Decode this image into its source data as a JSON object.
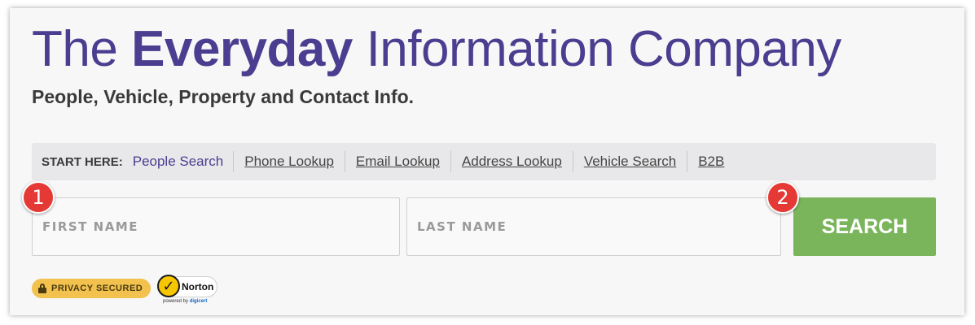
{
  "header": {
    "title_prefix": "The",
    "title_bold": "Everyday",
    "title_suffix": "Information Company",
    "subtitle": "People, Vehicle, Property and Contact Info."
  },
  "nav": {
    "start_label": "START HERE:",
    "items": [
      {
        "label": "People Search",
        "active": true
      },
      {
        "label": "Phone Lookup"
      },
      {
        "label": "Email Lookup"
      },
      {
        "label": "Address Lookup"
      },
      {
        "label": "Vehicle Search"
      },
      {
        "label": "B2B"
      }
    ]
  },
  "form": {
    "first_name_placeholder": "FIRST NAME",
    "last_name_placeholder": "LAST NAME",
    "search_label": "SEARCH"
  },
  "markers": [
    "1",
    "2"
  ],
  "badges": {
    "privacy": "PRIVACY SECURED",
    "norton": "Norton",
    "norton_powered": "powered by",
    "norton_by": "digicert"
  },
  "colors": {
    "brand": "#4b3d8f",
    "search_button": "#7ab55c",
    "marker": "#e53935",
    "privacy_badge": "#f2c14e"
  }
}
